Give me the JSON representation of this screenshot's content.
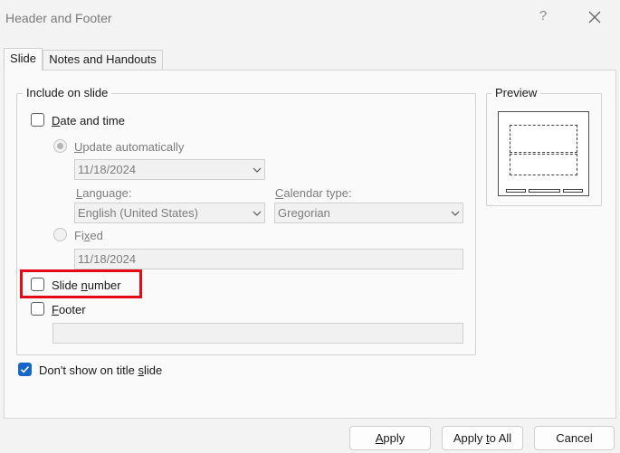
{
  "window": {
    "title": "Header and Footer",
    "help": "?"
  },
  "tabs": [
    {
      "label": "Slide"
    },
    {
      "label": "Notes and Handouts"
    }
  ],
  "include": {
    "legend": "Include on slide",
    "date_time": {
      "label_u": "D",
      "label_rest": "ate and time",
      "checked": false
    },
    "update_auto": {
      "label_u": "U",
      "label_rest": "pdate automatically",
      "date_value": "11/18/2024"
    },
    "language": {
      "label_u": "L",
      "label_rest": "anguage:",
      "value": "English (United States)"
    },
    "calendar": {
      "label_u": "C",
      "label_rest": "alendar type:",
      "value": "Gregorian"
    },
    "fixed": {
      "label_pre": "Fi",
      "label_u": "x",
      "label_rest": "ed",
      "value": "11/18/2024"
    },
    "slide_number": {
      "label_pre": "Slide ",
      "label_u": "n",
      "label_rest": "umber",
      "checked": false
    },
    "footer": {
      "label_u": "F",
      "label_rest": "ooter",
      "checked": false,
      "value": ""
    }
  },
  "dont_show": {
    "label_pre": "Don't show on title ",
    "label_u": "s",
    "label_rest": "lide",
    "checked": true
  },
  "preview": {
    "legend": "Preview"
  },
  "buttons": {
    "apply": {
      "label_u": "A",
      "label_rest": "pply"
    },
    "apply_all": {
      "label_pre": "Apply ",
      "label_u": "t",
      "label_rest": "o All"
    },
    "cancel": {
      "label": "Cancel"
    }
  },
  "colors": {
    "accent": "#1866c9",
    "highlight": "#e30b17"
  }
}
